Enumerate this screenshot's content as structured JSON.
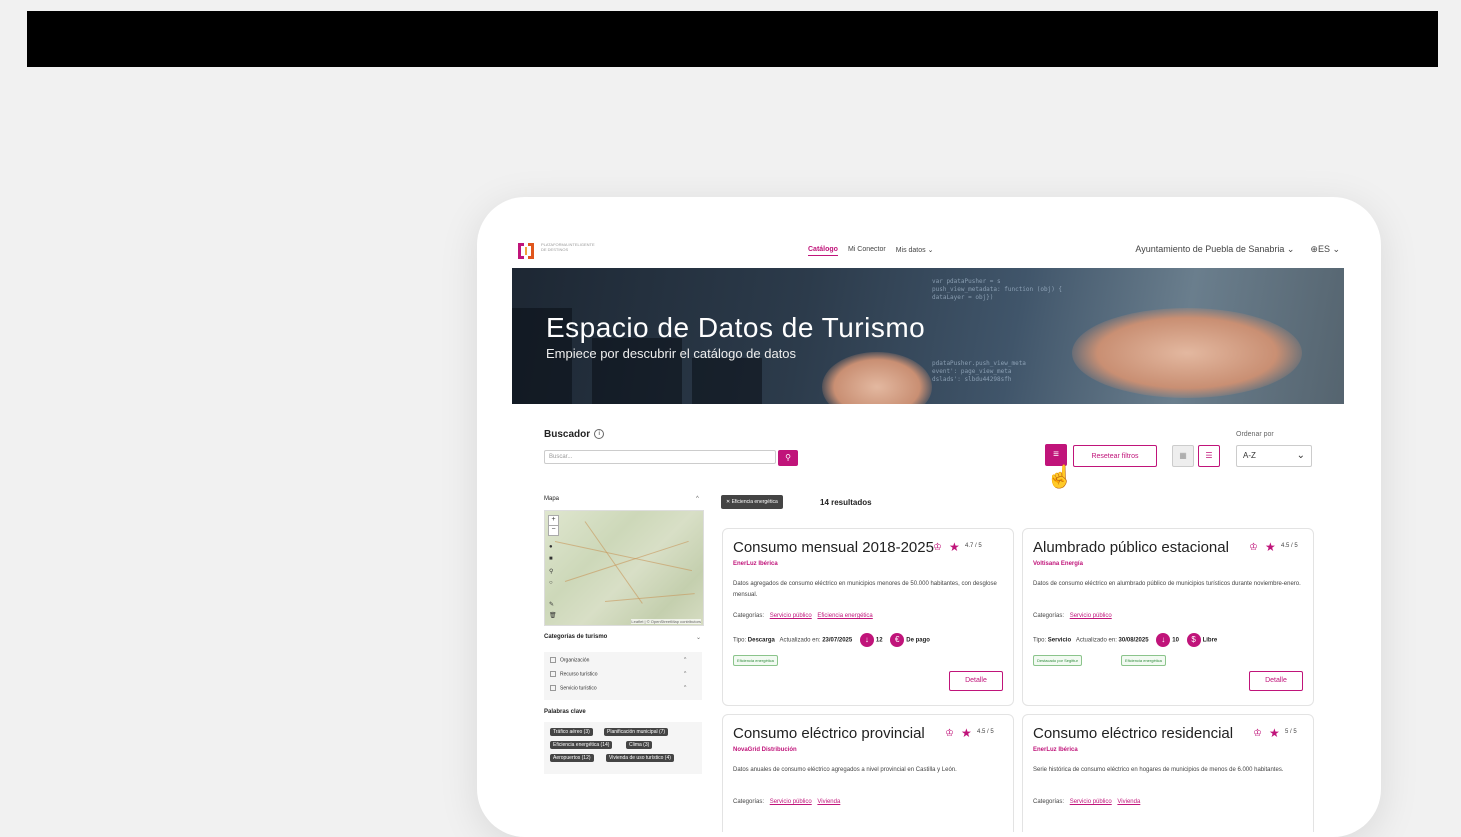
{
  "logo": {
    "text": "PLATAFORMA INTELIGENTE DE DESTINOS"
  },
  "nav": {
    "links": [
      "Catálogo",
      "Mi Conector",
      "Mis datos ⌄"
    ],
    "organization": "Ayuntamiento de Puebla de Sanabria ⌄",
    "language": "⊕ES ⌄"
  },
  "hero": {
    "title": "Espacio de Datos de Turismo",
    "subtitle": "Empiece por descubrir el catálogo de datos",
    "code_lines": [
      "var pdataPusher = s",
      "push_view_metadata: function (obj) {",
      "dataLayer = obj})",
      "pdataPusher.push_view_meta",
      "event': page_view_meta",
      "dslads': slbdu44298sfh"
    ]
  },
  "search": {
    "label": "Buscador",
    "placeholder": "Buscar..."
  },
  "toolbar": {
    "reset_label": "Resetear filtros",
    "sort_label": "Ordenar por",
    "sort_value": "A-Z"
  },
  "sidebar": {
    "map_label": "Mapa",
    "map_attribution": "Leaflet | © OpenStreetMap contributors",
    "categories_label": "Categorías de turismo",
    "categories": [
      "Organización",
      "Recurso turístico",
      "Servicio turístico"
    ],
    "keywords_label": "Palabras clave",
    "keywords": [
      "Tráfico aéreo (3)",
      "Planificación municipal (7)",
      "Eficiencia energética (14)",
      "Clima (3)",
      "Aeropuertos (12)",
      "Vivienda de uso turístico (4)"
    ]
  },
  "results": {
    "active_filter": "Eficiencia energética",
    "count": "14 resultados"
  },
  "cards": [
    {
      "title": "Consumo mensual 2018-2025",
      "rating": "4.7 / 5",
      "org": "EnerLuz Ibérica",
      "description": "Datos agregados de consumo eléctrico en municipios menores de 50.000 habitantes, con desglose mensual.",
      "categories_label": "Categorías:",
      "categories": [
        "Servicio público",
        "Eficiencia energética"
      ],
      "type_label": "Tipo:",
      "type": "Descarga",
      "updated_label": "Actualizado en:",
      "updated": "23/07/2025",
      "downloads": "12",
      "price": "De pago",
      "tags": [
        "Eficiencia energética"
      ],
      "detail_label": "Detalle"
    },
    {
      "title": "Alumbrado público estacional",
      "rating": "4.5 / 5",
      "org": "Voltisana Energía",
      "description": "Datos de consumo eléctrico en alumbrado público de municipios turísticos durante noviembre-enero.",
      "categories_label": "Categorías:",
      "categories": [
        "Servicio público"
      ],
      "type_label": "Tipo:",
      "type": "Servicio",
      "updated_label": "Actualizado en:",
      "updated": "30/08/2025",
      "downloads": "10",
      "price": "Libre",
      "tags": [
        "Destacado por Segittur",
        "Eficiencia energética"
      ],
      "detail_label": "Detalle"
    },
    {
      "title": "Consumo eléctrico provincial",
      "rating": "4.5 / 5",
      "org": "NovaGrid Distribución",
      "description": "Datos anuales de consumo eléctrico agregados a nivel provincial en Castilla y León.",
      "categories_label": "Categorías:",
      "categories": [
        "Servicio público",
        "Vivienda"
      ]
    },
    {
      "title": "Consumo eléctrico residencial",
      "rating": "5 / 5",
      "org": "EnerLuz Ibérica",
      "description": "Serie histórica de consumo eléctrico en hogares de municipios de menos de 6.000 habitantes.",
      "categories_label": "Categorías:",
      "categories": [
        "Servicio público",
        "Vivienda"
      ]
    }
  ],
  "colors": {
    "accent": "#c0147a",
    "background": "#f1f1f1"
  }
}
